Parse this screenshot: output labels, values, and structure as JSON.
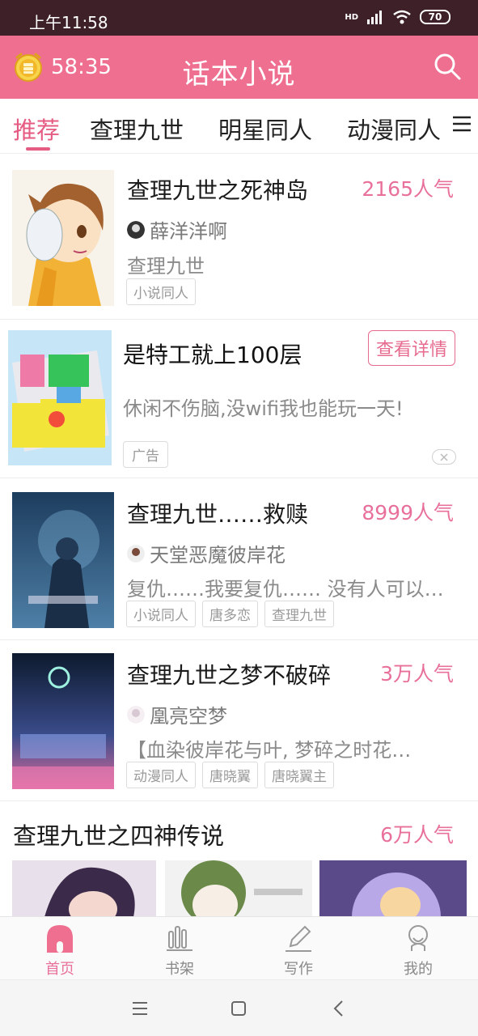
{
  "status_bar": {
    "time": "上午11:58",
    "network": "HD",
    "battery": "70"
  },
  "header": {
    "timer": "58:35",
    "title": "话本小说"
  },
  "tabs": [
    {
      "label": "推荐",
      "active": true
    },
    {
      "label": "查理九世",
      "active": false
    },
    {
      "label": "明星同人",
      "active": false
    },
    {
      "label": "动漫同人",
      "active": false
    }
  ],
  "books": [
    {
      "title": "查理九世之死神岛",
      "popularity": "2165人气",
      "author": "薛洋洋啊",
      "description": "查理九世",
      "tags": [
        "小说同人"
      ]
    },
    {
      "title": "查理九世……救赎",
      "popularity": "8999人气",
      "author": "天堂恶魔彼岸花",
      "description": "复仇……我要复仇…… 没有人可以…",
      "tags": [
        "小说同人",
        "唐多恋",
        "查理九世"
      ]
    },
    {
      "title": "查理九世之梦不破碎",
      "popularity": "3万人气",
      "author": "凰亮空梦",
      "description": "【血染彼岸花与叶, 梦碎之时花…",
      "tags": [
        "动漫同人",
        "唐晓翼",
        "唐晓翼主"
      ]
    }
  ],
  "ad": {
    "title": "是特工就上100层",
    "button": "查看详情",
    "description": "休闲不伤脑,没wifi我也能玩一天!",
    "badge": "广告"
  },
  "featured": {
    "title": "查理九世之四神传说",
    "popularity": "6万人气"
  },
  "bottom_nav": [
    {
      "label": "首页",
      "icon": "home-icon",
      "active": true
    },
    {
      "label": "书架",
      "icon": "bookshelf-icon",
      "active": false
    },
    {
      "label": "写作",
      "icon": "pencil-icon",
      "active": false
    },
    {
      "label": "我的",
      "icon": "profile-icon",
      "active": false
    }
  ],
  "colors": {
    "accent": "#ee6f8f",
    "accent_text": "#e8709a",
    "status_bar": "#3e2128"
  }
}
